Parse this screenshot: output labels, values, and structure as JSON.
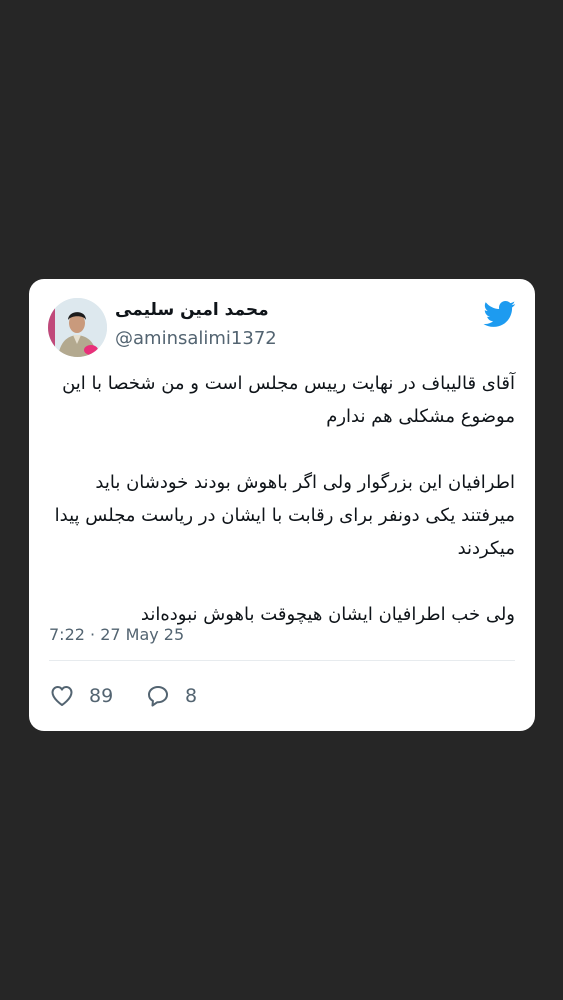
{
  "tweet": {
    "display_name": "محمد امین سلیمی",
    "handle": "@aminsalimi1372",
    "paragraphs": [
      "آقای قالیباف در نهایت رییس مجلس است و من شخصا با این موضوع مشکلی هم ندارم",
      "اطرافیان این بزرگوار ولی اگر باهوش بودند خودشان باید میرفتند یکی دونفر برای رقابت با ایشان در ریاست مجلس پیدا میکردند",
      "ولی خب اطرافیان ایشان هیچوقت باهوش نبوده‌اند"
    ],
    "timestamp": "7:22 · 27 May 25",
    "likes": "89",
    "replies": "8"
  },
  "icons": {
    "brand": "twitter-bird-icon",
    "like": "heart-icon",
    "reply": "speech-bubble-icon"
  },
  "colors": {
    "background": "#262626",
    "card": "#ffffff",
    "twitter_blue": "#1d9bf0",
    "text_primary": "#0f1419",
    "text_secondary": "#536471"
  }
}
